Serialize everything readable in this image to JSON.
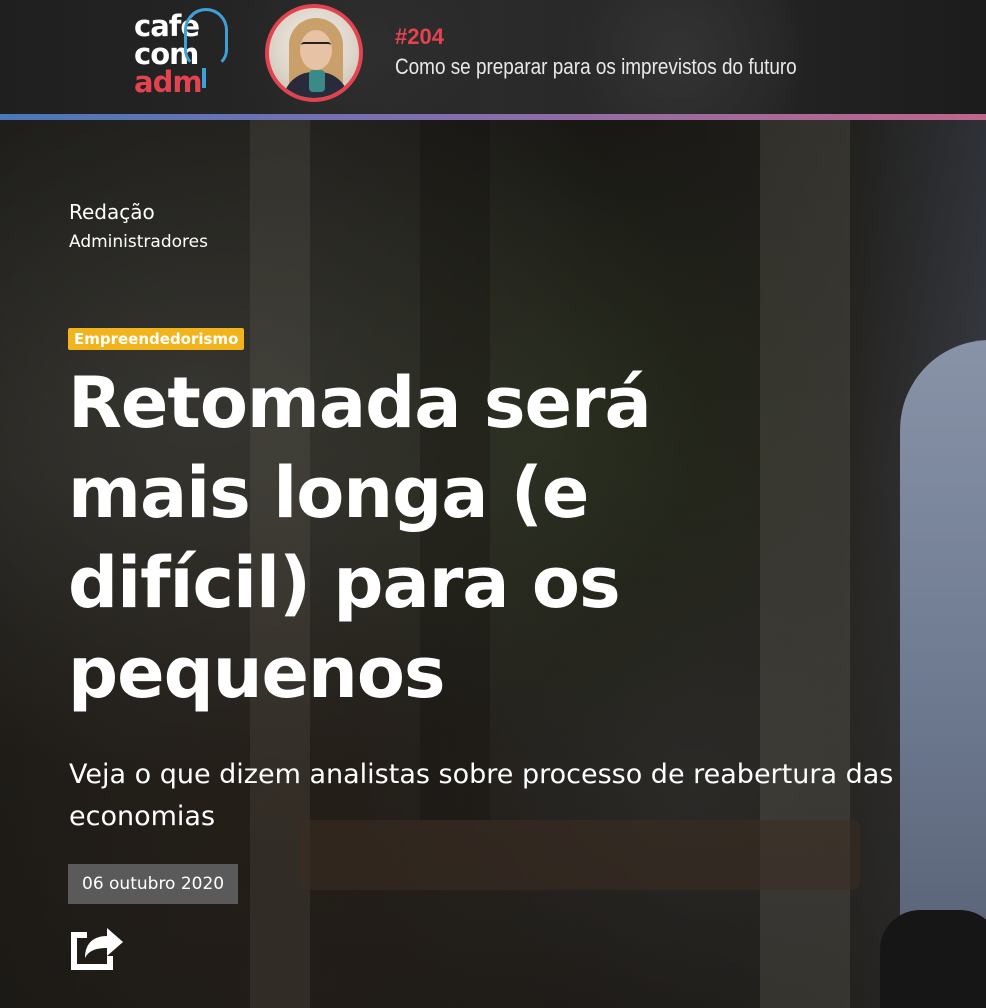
{
  "banner": {
    "logo": {
      "line1": "café",
      "line2": "com",
      "line3": "adm"
    },
    "episode_number": "#204",
    "episode_title": "Como se preparar para os imprevistos do futuro"
  },
  "article": {
    "author_name": "Redação",
    "author_org": "Administradores",
    "category": "Empreendedorismo",
    "headline": "Retomada será mais longa (e difícil) para os pequenos",
    "subtitle": "Veja o que dizem analistas sobre processo de reabertura das economias",
    "date": "06 outubro 2020"
  },
  "icons": {
    "share": "share-icon",
    "cup": "coffee-mic-icon"
  },
  "colors": {
    "accent_red": "#e2434f",
    "accent_blue": "#3fa0d8",
    "category_bg": "#f2b41c",
    "date_bg": "#5a5a5a"
  }
}
